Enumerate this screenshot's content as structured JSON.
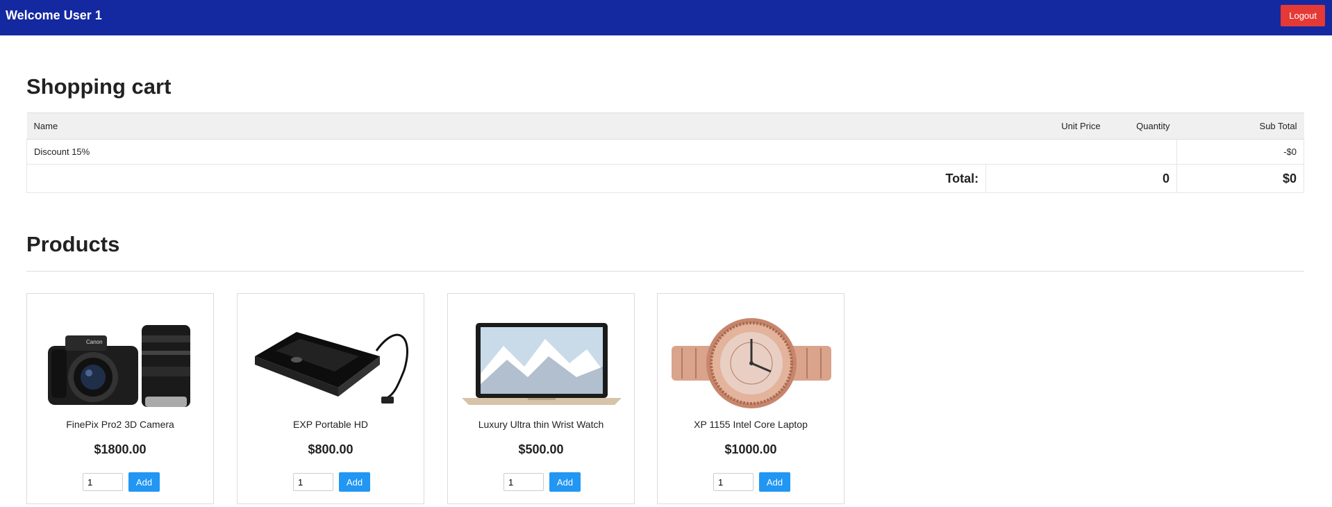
{
  "header": {
    "welcome": "Welcome User 1",
    "logout_label": "Logout",
    "bg_color": "#1428a0"
  },
  "cart": {
    "title": "Shopping cart",
    "columns": {
      "name": "Name",
      "unit_price": "Unit Price",
      "quantity": "Quantity",
      "sub_total": "Sub Total"
    },
    "discount": {
      "label": "Discount 15%",
      "amount": "-$0"
    },
    "total": {
      "label": "Total:",
      "quantity": "0",
      "amount": "$0"
    }
  },
  "products": {
    "title": "Products",
    "items": [
      {
        "name": "FinePix Pro2 3D Camera",
        "price": "$1800.00",
        "qty": "1",
        "add_label": "Add",
        "icon": "camera-image"
      },
      {
        "name": "EXP Portable HD",
        "price": "$800.00",
        "qty": "1",
        "add_label": "Add",
        "icon": "hard-drive-image"
      },
      {
        "name": "Luxury Ultra thin Wrist Watch",
        "price": "$500.00",
        "qty": "1",
        "add_label": "Add",
        "icon": "laptop-image"
      },
      {
        "name": "XP 1155 Intel Core Laptop",
        "price": "$1000.00",
        "qty": "1",
        "add_label": "Add",
        "icon": "watch-image"
      }
    ]
  }
}
